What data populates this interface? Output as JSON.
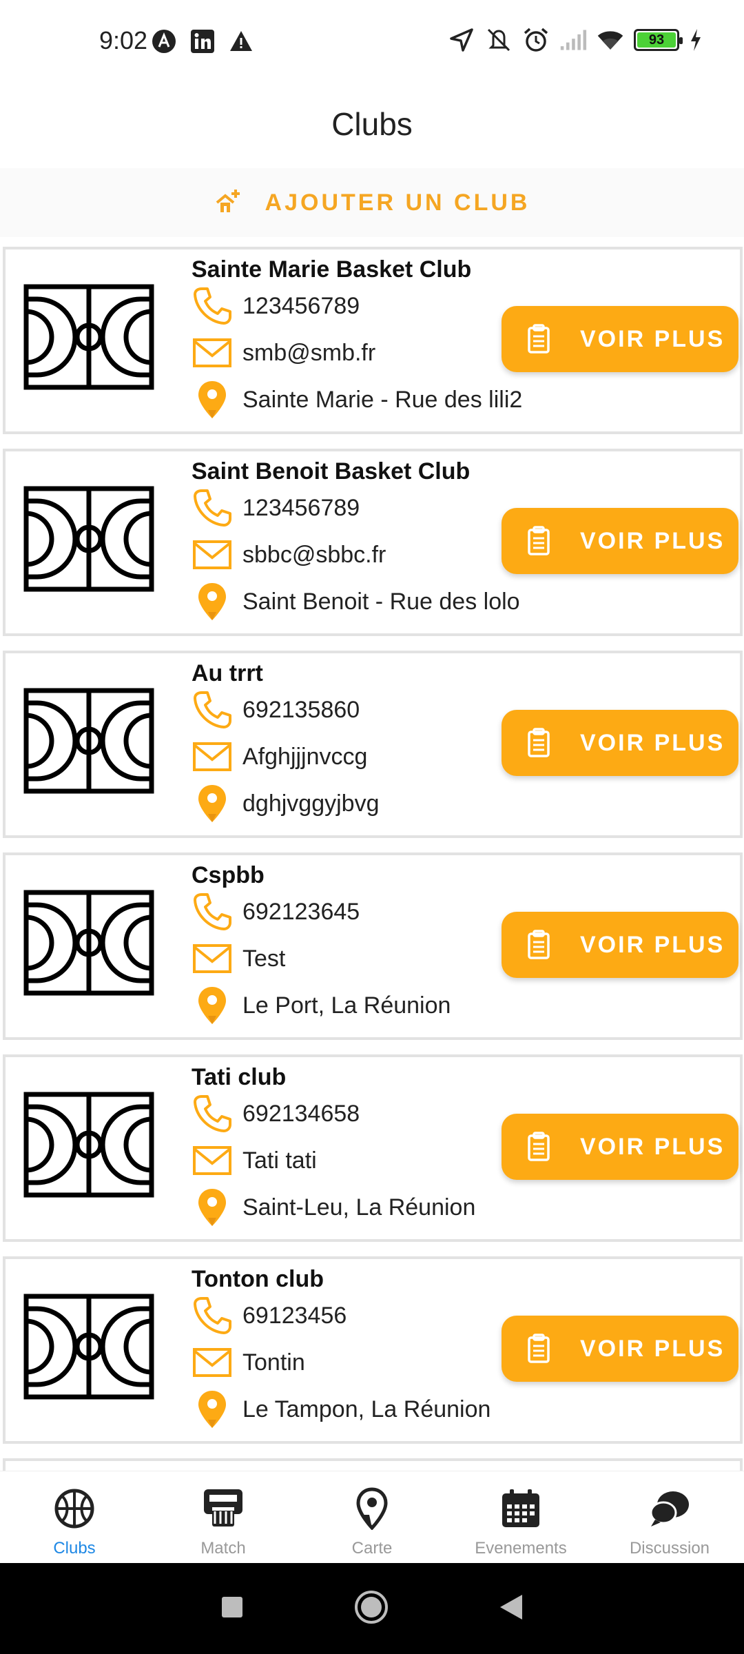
{
  "status": {
    "time": "9:02",
    "battery": "93"
  },
  "app": {
    "title": "Clubs"
  },
  "add_club": {
    "label": "AJOUTER UN CLUB"
  },
  "clubs": [
    {
      "name": "Sainte Marie Basket Club",
      "phone": "123456789",
      "email": "smb@smb.fr",
      "address": "Sainte Marie - Rue des lili2",
      "button": "VOIR PLUS"
    },
    {
      "name": "Saint Benoit Basket Club",
      "phone": "123456789",
      "email": "sbbc@sbbc.fr",
      "address": "Saint Benoit - Rue des lolo",
      "button": "VOIR PLUS"
    },
    {
      "name": "Au trrt",
      "phone": "692135860",
      "email": "Afghjjjnvccg",
      "address": "dghjvggyjbvg",
      "button": "VOIR PLUS"
    },
    {
      "name": "Cspbb",
      "phone": "692123645",
      "email": "Test",
      "address": "Le Port, La Réunion",
      "button": "VOIR PLUS"
    },
    {
      "name": "Tati club",
      "phone": "692134658",
      "email": "Tati tati",
      "address": "Saint-Leu, La Réunion",
      "button": "VOIR PLUS"
    },
    {
      "name": "Tonton club",
      "phone": "69123456",
      "email": "Tontin",
      "address": "Le Tampon, La Réunion",
      "button": "VOIR PLUS"
    }
  ],
  "nav": [
    {
      "label": "Clubs",
      "icon": "basketball-icon",
      "active": true
    },
    {
      "label": "Match",
      "icon": "scoreboard-icon",
      "active": false
    },
    {
      "label": "Carte",
      "icon": "map-pin-icon",
      "active": false
    },
    {
      "label": "Evenements",
      "icon": "calendar-icon",
      "active": false
    },
    {
      "label": "Discussion",
      "icon": "chat-icon",
      "active": false
    }
  ],
  "colors": {
    "accent": "#fdaa14",
    "active_nav": "#1e88e5",
    "nav_inactive": "#999999"
  }
}
